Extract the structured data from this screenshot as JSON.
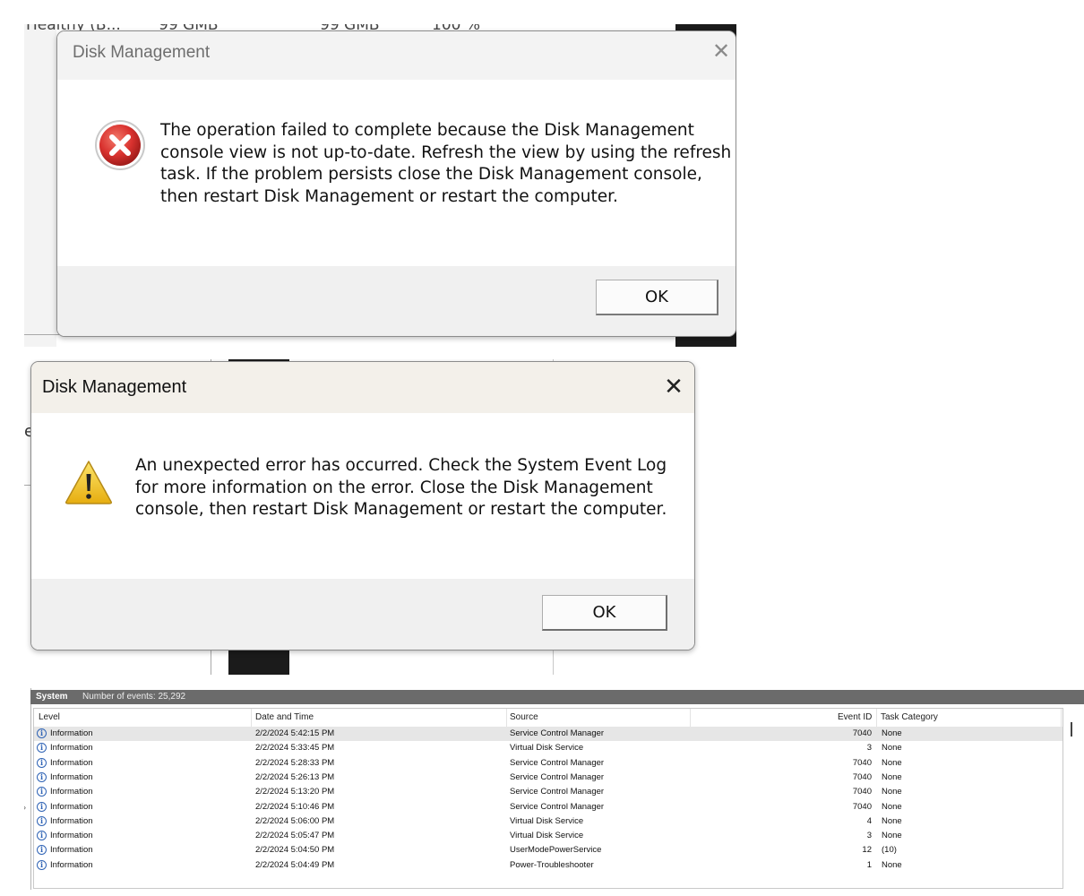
{
  "background": {
    "partial_text": [
      "Healthy (B...",
      "99 GMB",
      "99 GMB",
      "100 %"
    ],
    "partial_letter": "e"
  },
  "dialog1": {
    "title": "Disk Management",
    "message": "The operation failed to complete because the Disk Management console view is not up-to-date.  Refresh the view by using the refresh task. If the problem persists close the Disk Management console, then restart Disk Management or restart the computer.",
    "ok_label": "OK",
    "icon": "error-icon",
    "colors": {
      "icon": "#d9322f"
    }
  },
  "dialog2": {
    "title": "Disk Management",
    "message": "An unexpected error has occurred. Check the System Event Log for more information on the error. Close the Disk Management console, then restart Disk Management or restart the computer.",
    "ok_label": "OK",
    "icon": "warning-icon",
    "colors": {
      "icon": "#f2c21b"
    }
  },
  "event_viewer": {
    "log_name": "System",
    "event_count": "Number of events: 25,292",
    "columns": {
      "level": "Level",
      "date": "Date and Time",
      "source": "Source",
      "event_id": "Event ID",
      "task": "Task Category"
    },
    "rows": [
      {
        "level": "Information",
        "date": "2/2/2024 5:42:15 PM",
        "source": "Service Control Manager",
        "event_id": "7040",
        "task": "None"
      },
      {
        "level": "Information",
        "date": "2/2/2024 5:33:45 PM",
        "source": "Virtual Disk Service",
        "event_id": "3",
        "task": "None"
      },
      {
        "level": "Information",
        "date": "2/2/2024 5:28:33 PM",
        "source": "Service Control Manager",
        "event_id": "7040",
        "task": "None"
      },
      {
        "level": "Information",
        "date": "2/2/2024 5:26:13 PM",
        "source": "Service Control Manager",
        "event_id": "7040",
        "task": "None"
      },
      {
        "level": "Information",
        "date": "2/2/2024 5:13:20 PM",
        "source": "Service Control Manager",
        "event_id": "7040",
        "task": "None"
      },
      {
        "level": "Information",
        "date": "2/2/2024 5:10:46 PM",
        "source": "Service Control Manager",
        "event_id": "7040",
        "task": "None"
      },
      {
        "level": "Information",
        "date": "2/2/2024 5:06:00 PM",
        "source": "Virtual Disk Service",
        "event_id": "4",
        "task": "None"
      },
      {
        "level": "Information",
        "date": "2/2/2024 5:05:47 PM",
        "source": "Virtual Disk Service",
        "event_id": "3",
        "task": "None"
      },
      {
        "level": "Information",
        "date": "2/2/2024 5:04:50 PM",
        "source": "UserModePowerService",
        "event_id": "12",
        "task": "(10)"
      },
      {
        "level": "Information",
        "date": "2/2/2024 5:04:49 PM",
        "source": "Power-Troubleshooter",
        "event_id": "1",
        "task": "None"
      }
    ]
  }
}
